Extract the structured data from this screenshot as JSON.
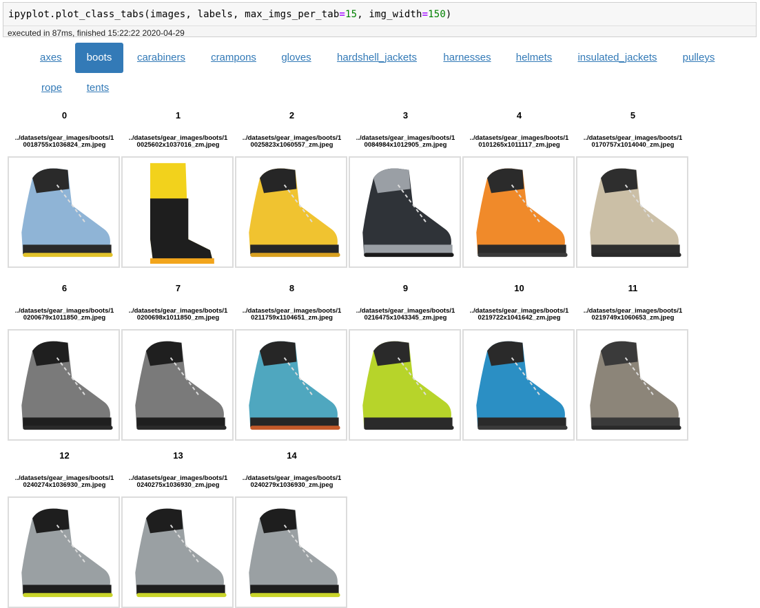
{
  "cell": {
    "code_parts": {
      "p1": "ipyplot.plot_class_tabs(images, labels, max_imgs_per_tab",
      "eq1": "=",
      "n1": "15",
      "p2": ", img_width",
      "eq2": "=",
      "n2": "150",
      "p3": ")"
    },
    "exec_info": "executed in 87ms, finished 15:22:22 2020-04-29"
  },
  "tabs": [
    {
      "label": "axes",
      "active": false
    },
    {
      "label": "boots",
      "active": true
    },
    {
      "label": "carabiners",
      "active": false
    },
    {
      "label": "crampons",
      "active": false
    },
    {
      "label": "gloves",
      "active": false
    },
    {
      "label": "hardshell_jackets",
      "active": false
    },
    {
      "label": "harnesses",
      "active": false
    },
    {
      "label": "helmets",
      "active": false
    },
    {
      "label": "insulated_jackets",
      "active": false
    },
    {
      "label": "pulleys",
      "active": false
    },
    {
      "label": "rope",
      "active": false
    },
    {
      "label": "tents",
      "active": false
    }
  ],
  "images": [
    {
      "index": "0",
      "path": "../datasets/gear_images/boots/10018755x1036824_zm.jpeg",
      "colors": {
        "main": "#8fb4d6",
        "accent": "#2a2a2a",
        "sole": "#e2c22a"
      },
      "icon": "boot-image"
    },
    {
      "index": "1",
      "path": "../datasets/gear_images/boots/10025602x1037016_zm.jpeg",
      "colors": {
        "main": "#f2d21c",
        "accent": "#1e1e1e",
        "sole": "#f2a51c"
      },
      "icon": "boot-image"
    },
    {
      "index": "2",
      "path": "../datasets/gear_images/boots/10025823x1060557_zm.jpeg",
      "colors": {
        "main": "#f0c330",
        "accent": "#262626",
        "sole": "#d8a020"
      },
      "icon": "boot-image"
    },
    {
      "index": "3",
      "path": "../datasets/gear_images/boots/10084984x1012905_zm.jpeg",
      "colors": {
        "main": "#2f3338",
        "accent": "#9a9fa5",
        "sole": "#1a1a1a"
      },
      "icon": "boot-image"
    },
    {
      "index": "4",
      "path": "../datasets/gear_images/boots/10101265x1011117_zm.jpeg",
      "colors": {
        "main": "#f08a2a",
        "accent": "#2b2b2b",
        "sole": "#3a3a3a"
      },
      "icon": "boot-image"
    },
    {
      "index": "5",
      "path": "../datasets/gear_images/boots/10170757x1014040_zm.jpeg",
      "colors": {
        "main": "#cbbfa6",
        "accent": "#2e2e2e",
        "sole": "#2a2a2a"
      },
      "icon": "boot-image"
    },
    {
      "index": "6",
      "path": "../datasets/gear_images/boots/10200679x1011850_zm.jpeg",
      "colors": {
        "main": "#7a7a7a",
        "accent": "#1f1f1f",
        "sole": "#2a2a2a"
      },
      "icon": "boot-image"
    },
    {
      "index": "7",
      "path": "../datasets/gear_images/boots/10200698x1011850_zm.jpeg",
      "colors": {
        "main": "#7a7a7a",
        "accent": "#1f1f1f",
        "sole": "#2a2a2a"
      },
      "icon": "boot-image"
    },
    {
      "index": "8",
      "path": "../datasets/gear_images/boots/10211759x1104651_zm.jpeg",
      "colors": {
        "main": "#4fa7bf",
        "accent": "#262626",
        "sole": "#c45a2a"
      },
      "icon": "boot-image"
    },
    {
      "index": "9",
      "path": "../datasets/gear_images/boots/10216475x1043345_zm.jpeg",
      "colors": {
        "main": "#b7d42a",
        "accent": "#2a2a2a",
        "sole": "#2a2a2a"
      },
      "icon": "boot-image"
    },
    {
      "index": "10",
      "path": "../datasets/gear_images/boots/10219722x1041642_zm.jpeg",
      "colors": {
        "main": "#2b8fc4",
        "accent": "#2a2a2a",
        "sole": "#3a3a3a"
      },
      "icon": "boot-image"
    },
    {
      "index": "11",
      "path": "../datasets/gear_images/boots/10219749x1060653_zm.jpeg",
      "colors": {
        "main": "#8c8579",
        "accent": "#3a3a3a",
        "sole": "#2a2a2a"
      },
      "icon": "boot-image"
    },
    {
      "index": "12",
      "path": "../datasets/gear_images/boots/10240274x1036930_zm.jpeg",
      "colors": {
        "main": "#9aa0a3",
        "accent": "#1e1e1e",
        "sole": "#c9d42a"
      },
      "icon": "boot-image"
    },
    {
      "index": "13",
      "path": "../datasets/gear_images/boots/10240275x1036930_zm.jpeg",
      "colors": {
        "main": "#9aa0a3",
        "accent": "#1e1e1e",
        "sole": "#c9d42a"
      },
      "icon": "boot-image"
    },
    {
      "index": "14",
      "path": "../datasets/gear_images/boots/10240279x1036930_zm.jpeg",
      "colors": {
        "main": "#9aa0a3",
        "accent": "#1e1e1e",
        "sole": "#c9d42a"
      },
      "icon": "boot-image"
    }
  ]
}
